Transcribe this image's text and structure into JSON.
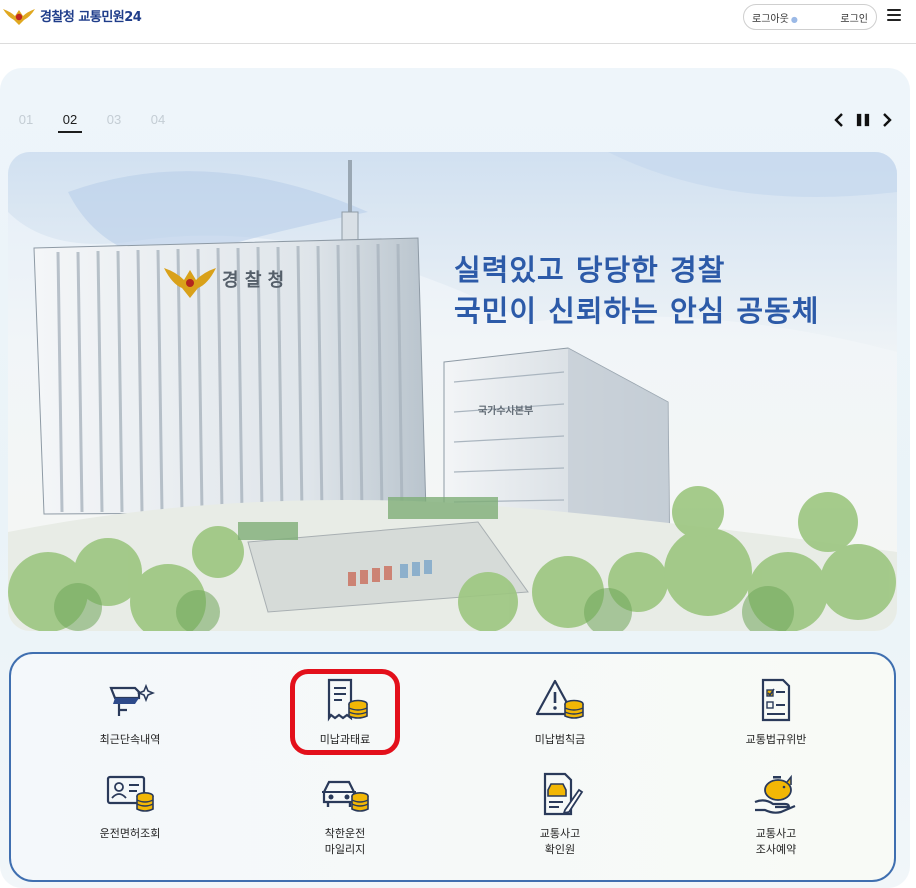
{
  "header": {
    "site_title": "경찰청 교통민원24",
    "logout_label": "로그아웃",
    "login_label": "로그인"
  },
  "slider": {
    "pages": [
      "01",
      "02",
      "03",
      "04"
    ],
    "active_page": "02"
  },
  "banner": {
    "slogan_line1": "실력있고 당당한 경찰",
    "slogan_line2": "국민이 신뢰하는 안심 공동체",
    "building_sign": "경 찰 청",
    "annex_sign": "국가수사본부"
  },
  "quick_menu": [
    {
      "label": "최근단속내역",
      "icon": "camera-icon"
    },
    {
      "label": "미납과태료",
      "icon": "receipt-coins-icon"
    },
    {
      "label": "미납범칙금",
      "icon": "warning-coins-icon"
    },
    {
      "label": "교통법규위반",
      "icon": "checklist-icon"
    },
    {
      "label": "운전면허조회",
      "icon": "id-card-coins-icon"
    },
    {
      "label": "착한운전\n마일리지",
      "icon": "car-coins-icon"
    },
    {
      "label": "교통사고\n확인원",
      "icon": "document-car-icon"
    },
    {
      "label": "교통사고\n조사예약",
      "icon": "piggy-hand-icon"
    }
  ],
  "colors": {
    "brand_blue": "#1f3d8a",
    "slogan_blue": "#2c5aa8",
    "coin_gold": "#f2b705",
    "highlight_red": "#e3101b"
  }
}
